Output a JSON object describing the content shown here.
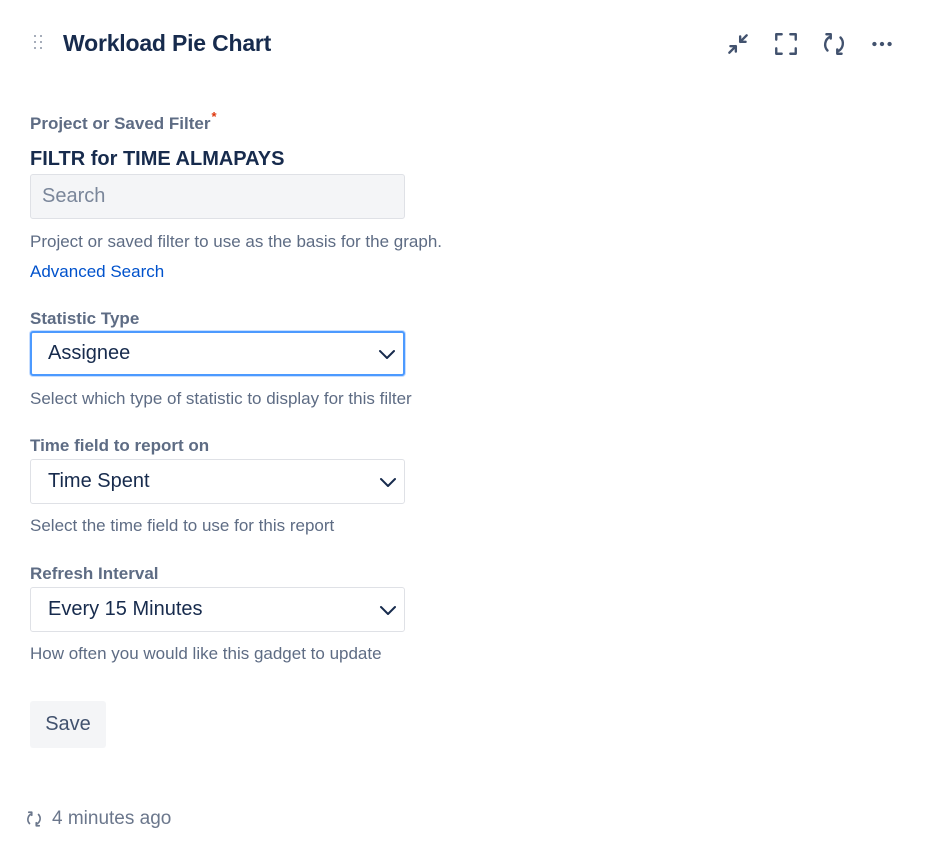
{
  "header": {
    "title": "Workload Pie Chart",
    "icons": [
      "drag-handle-icon",
      "minimize-icon",
      "fullscreen-icon",
      "refresh-icon",
      "more-icon"
    ]
  },
  "form": {
    "project_filter": {
      "label": "Project or Saved Filter",
      "required_mark": "*",
      "selected_name": "FILTR for TIME ALMAPAYS",
      "placeholder": "Search",
      "help": "Project or saved filter to use as the basis for the graph.",
      "link": "Advanced Search"
    },
    "statistic_type": {
      "label": "Statistic Type",
      "value": "Assignee",
      "help": "Select which type of statistic to display for this filter"
    },
    "time_field": {
      "label": "Time field to report on",
      "value": "Time Spent",
      "help": "Select the time field to use for this report"
    },
    "refresh_interval": {
      "label": "Refresh Interval",
      "value": "Every 15 Minutes",
      "help": "How often you would like this gadget to update"
    },
    "save_label": "Save"
  },
  "footer": {
    "updated": "4 minutes ago"
  },
  "colors": {
    "title": "#172b4d",
    "label": "#5e6c84",
    "link": "#0052cc",
    "required": "#de350b",
    "focus_ring": "#4c9aff",
    "input_bg": "#f4f5f7"
  }
}
